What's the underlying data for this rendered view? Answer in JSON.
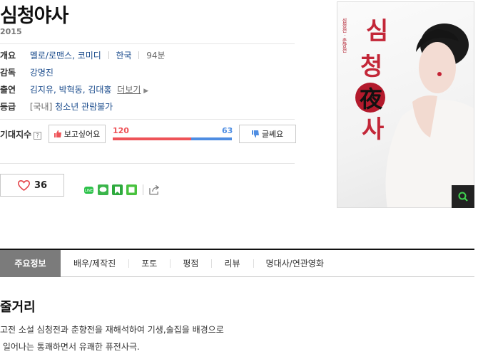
{
  "movie": {
    "title": "심청야사",
    "year": "2015",
    "overview_label": "개요",
    "genre": "멜로/로맨스, 코미디",
    "country": "한국",
    "runtime": "94분",
    "director_label": "감독",
    "director": "강명진",
    "cast_label": "출연",
    "cast": "김지유, 박혁동, 김대홍",
    "more_label": "더보기",
    "rating_label": "등급",
    "rating_prefix": "[국내]",
    "rating": "청소년 관람불가"
  },
  "expectation": {
    "label": "기대지수",
    "help_icon": "?",
    "want_label": "보고싶어요",
    "notsure_label": "글쎄요",
    "want_count": 120,
    "notsure_count": 63,
    "want_color": "#ee5358",
    "notsure_color": "#4e8de2"
  },
  "like": {
    "count": "36",
    "icon": "heart-icon"
  },
  "share": {
    "icons": [
      "line-icon",
      "kakao-icon",
      "bookmark-icon",
      "square-icon",
      "share-icon"
    ]
  },
  "poster": {
    "title_chars": [
      "심",
      "청",
      "夜",
      "사"
    ],
    "subtitle": "심청전 · 춘향전"
  },
  "tabs": [
    "주요정보",
    "배우/제작진",
    "포토",
    "평점",
    "리뷰",
    "명대사/연관영화"
  ],
  "synopsis": {
    "title": "줄거리",
    "line1": "고전 소설 심청전과 춘향전을 재해석하여 기생,술집을 배경으로",
    "line2": " 일어나는 통쾌하면서 유쾌한 퓨전사극."
  }
}
